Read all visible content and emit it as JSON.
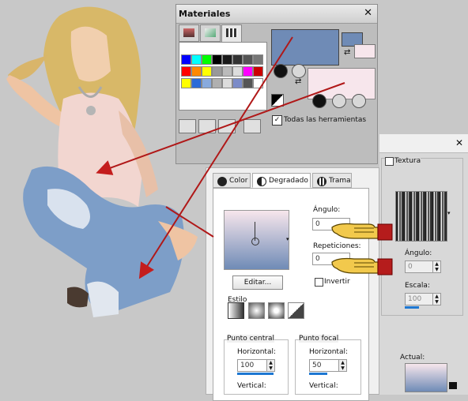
{
  "materials": {
    "title": "Materiales",
    "close_glyph": "✕",
    "all_tools_label": "Todas las herramientas",
    "all_tools_checked": true,
    "colors": {
      "foreground": "#6f8bb6",
      "background": "#f7e6ec"
    },
    "swatch_rows": [
      [
        "#0000ff",
        "#00ffff",
        "#00ff00",
        "#000000",
        "#1a1a1a",
        "#333333",
        "#555555",
        "#777777"
      ],
      [
        "#ff0000",
        "#ff8800",
        "#ffff00",
        "#999999",
        "#bbbbbb",
        "#dddddd",
        "#ff00ff",
        "#cc0000"
      ],
      [
        "#ffff00",
        "#2a6ad8",
        "#88aadd",
        "#b0b0b0",
        "#dcdcdc",
        "#7b8bc8",
        "#555555",
        "#ffffff"
      ]
    ]
  },
  "gradient": {
    "tabs": [
      {
        "label": "Color"
      },
      {
        "label": "Degradado"
      },
      {
        "label": "Trama"
      }
    ],
    "active_tab": "Degradado",
    "edit_label": "Editar...",
    "angle_label": "Ángulo:",
    "angle_value": "0",
    "repeat_label": "Repeticiones:",
    "repeat_value": "0",
    "invert_label": "Invertir",
    "style_label": "Estilo",
    "center_group": "Punto central",
    "focal_group": "Punto focal",
    "horizontal_label": "Horizontal:",
    "vertical_label": "Vertical:",
    "center_h_value": "100",
    "focal_h_value": "50"
  },
  "texture": {
    "label": "Textura",
    "angle_label": "Ángulo:",
    "angle_value": "0",
    "scale_label": "Escala:",
    "scale_value": "100",
    "current_label": "Actual:",
    "close_glyph": "✕"
  }
}
